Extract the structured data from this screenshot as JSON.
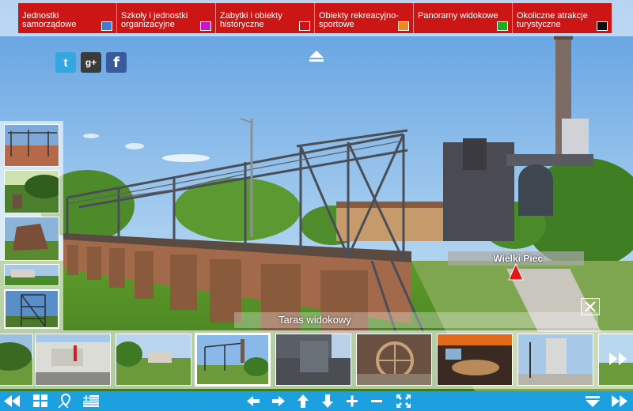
{
  "categories": [
    {
      "label": "Jednostki samorządowe",
      "color": "#3a7ed6"
    },
    {
      "label": "Szkoły i jednostki organizacyjne",
      "color": "#c815d0"
    },
    {
      "label": "Zabytki i obiekty historyczne",
      "color": "#d01010"
    },
    {
      "label": "Obiekty rekreacyjno-sportowe",
      "color": "#f08a20"
    },
    {
      "label": "Panoramy widokowe",
      "color": "#18b020"
    },
    {
      "label": "Okoliczne atrakcje turystyczne",
      "color": "#111111"
    }
  ],
  "social": {
    "twitter_glyph": "t",
    "googleplus_glyph": "g+",
    "facebook_glyph": "f"
  },
  "hotspot": {
    "label": "Wielki Piec"
  },
  "scene_title": "Taras widokowy",
  "colors": {
    "menu_red": "#cc1515",
    "toolbar_blue": "#1da0e0",
    "hotspot_red": "#e01818"
  },
  "icons": {
    "toolbar": [
      "rewind-icon",
      "grid-icon",
      "map-pin-icon",
      "flag-icon",
      "arrow-left-icon",
      "arrow-right-icon",
      "arrow-up-icon",
      "arrow-down-icon",
      "zoom-in-icon",
      "zoom-out-icon",
      "fullscreen-icon",
      "chevron-down-icon",
      "fast-forward-icon"
    ]
  }
}
